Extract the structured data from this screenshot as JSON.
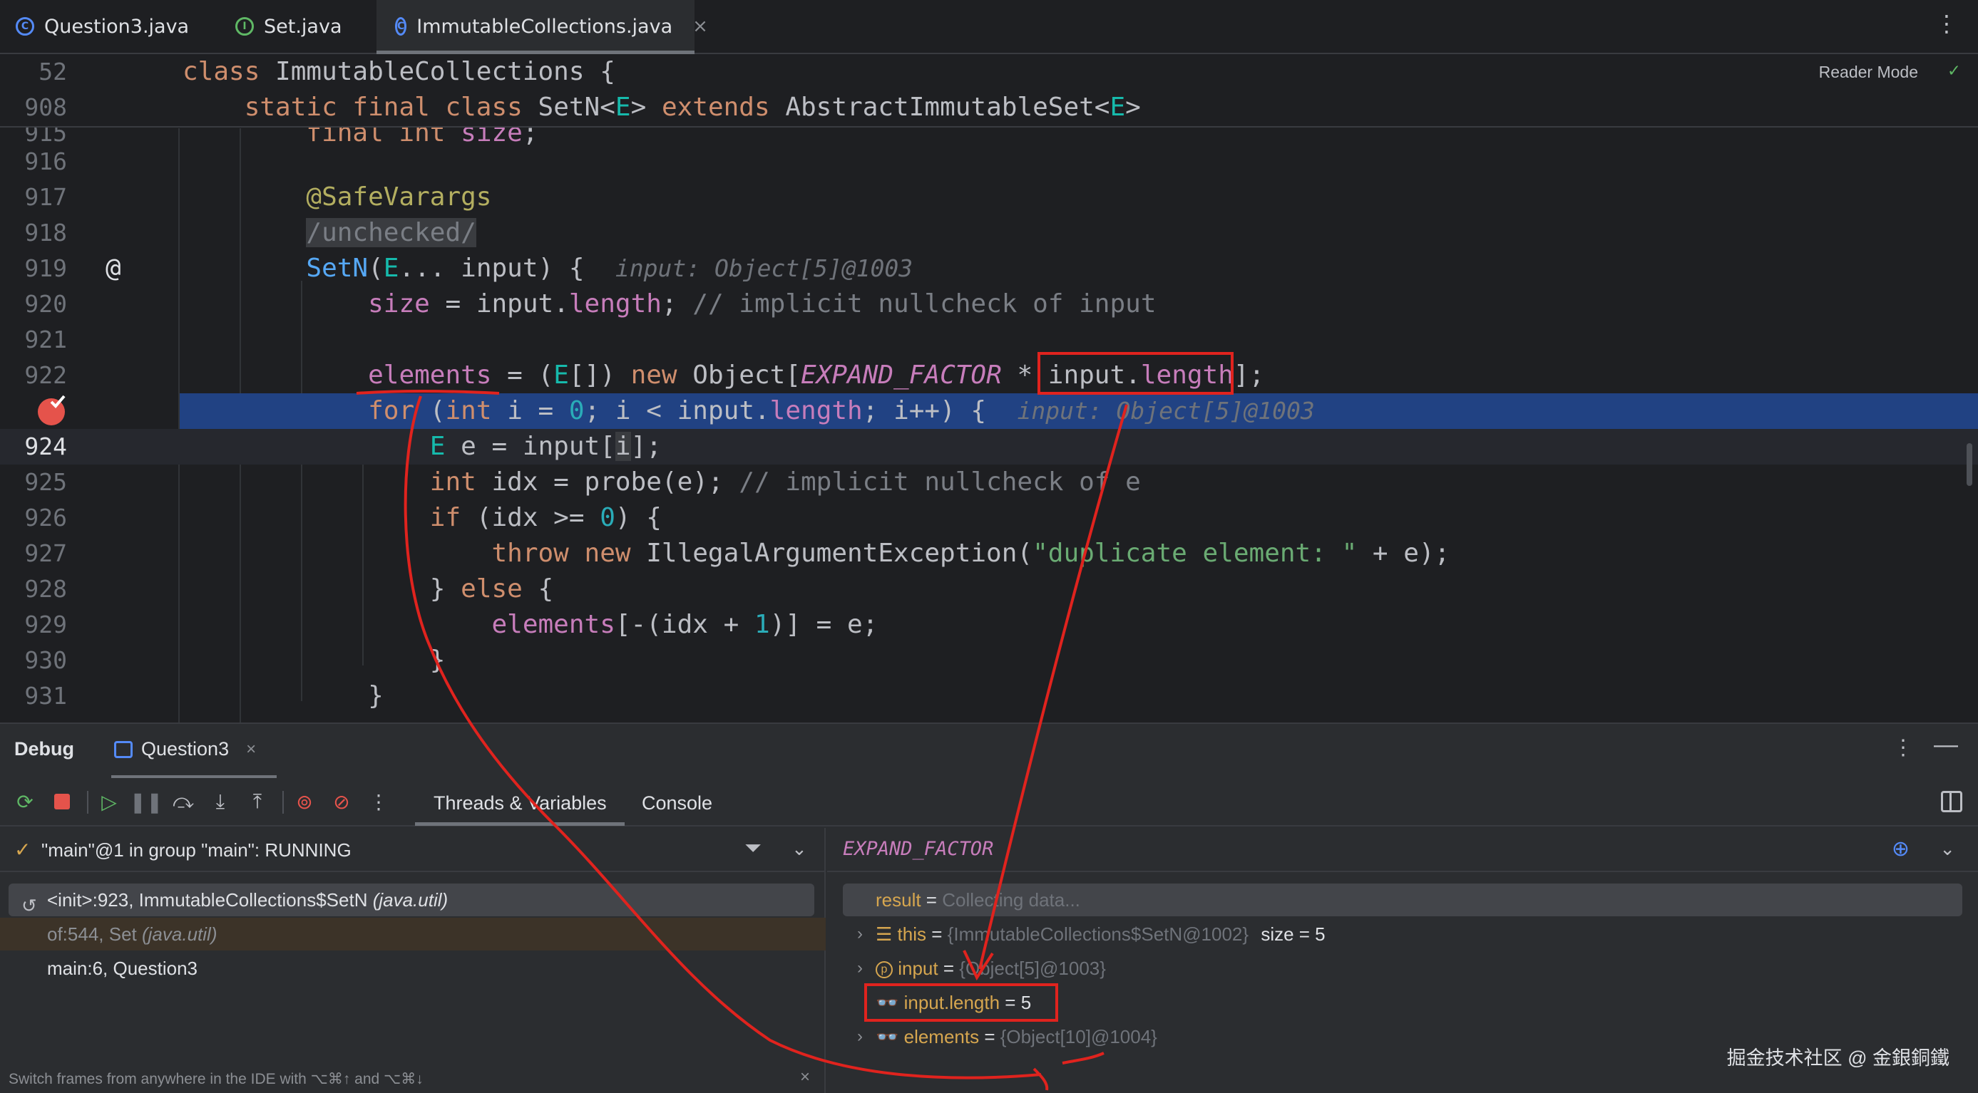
{
  "tabs": [
    {
      "label": "Question3.java",
      "icon": "class-icon"
    },
    {
      "label": "Set.java",
      "icon": "interface-icon"
    },
    {
      "label": "ImmutableCollections.java",
      "icon": "class-icon",
      "close": "×"
    }
  ],
  "tab_menu": "⋮",
  "editor": {
    "reader_mode": "Reader Mode",
    "reader_check": "✓",
    "sticky": [
      {
        "num": "52"
      },
      {
        "num": "908"
      }
    ],
    "lines": [
      {
        "num": "915"
      },
      {
        "num": "916"
      },
      {
        "num": "917"
      },
      {
        "num": "918"
      },
      {
        "num": "919"
      },
      {
        "num": "920"
      },
      {
        "num": "921"
      },
      {
        "num": "922"
      },
      {
        "num": ""
      },
      {
        "num": "924"
      },
      {
        "num": "925"
      },
      {
        "num": "926"
      },
      {
        "num": "927"
      },
      {
        "num": "928"
      },
      {
        "num": "929"
      },
      {
        "num": "930"
      },
      {
        "num": "931"
      }
    ],
    "gutter_at": "@"
  },
  "debug": {
    "title": "Debug",
    "session": "Question3",
    "session_close": "×",
    "menu": "⋮",
    "minimize": "—",
    "tabs": [
      "Threads & Variables",
      "Console"
    ],
    "thread_status": "\"main\"@1 in group \"main\": RUNNING",
    "frames": [
      {
        "method": "<init>:923, ImmutableCollections$SetN",
        "pkg": "(java.util)"
      },
      {
        "method": "of:544, Set",
        "pkg": "(java.util)"
      },
      {
        "method": "main:6, Question3",
        "pkg": ""
      }
    ],
    "hint": "Switch frames from anywhere in the IDE with ⌥⌘↑ and ⌥⌘↓",
    "hint_close": "×",
    "eval_expression": "EXPAND_FACTOR",
    "variables": [
      {
        "name": "result",
        "value": "Collecting data...",
        "extra": ""
      },
      {
        "name": "this",
        "value": "{ImmutableCollections$SetN@1002}",
        "extra": "size = 5"
      },
      {
        "name": "input",
        "value": "{Object[5]@1003}",
        "extra": ""
      },
      {
        "name": "input.length",
        "value": "5",
        "extra": ""
      },
      {
        "name": "elements",
        "value": "{Object[10]@1004}",
        "extra": ""
      }
    ],
    "eq": " = "
  },
  "watermark": "掘金技术社区 @ 金銀銅鐵",
  "colors": {
    "accent": "#548af7",
    "highlight": "#214283",
    "annotation": "#e0231e"
  }
}
